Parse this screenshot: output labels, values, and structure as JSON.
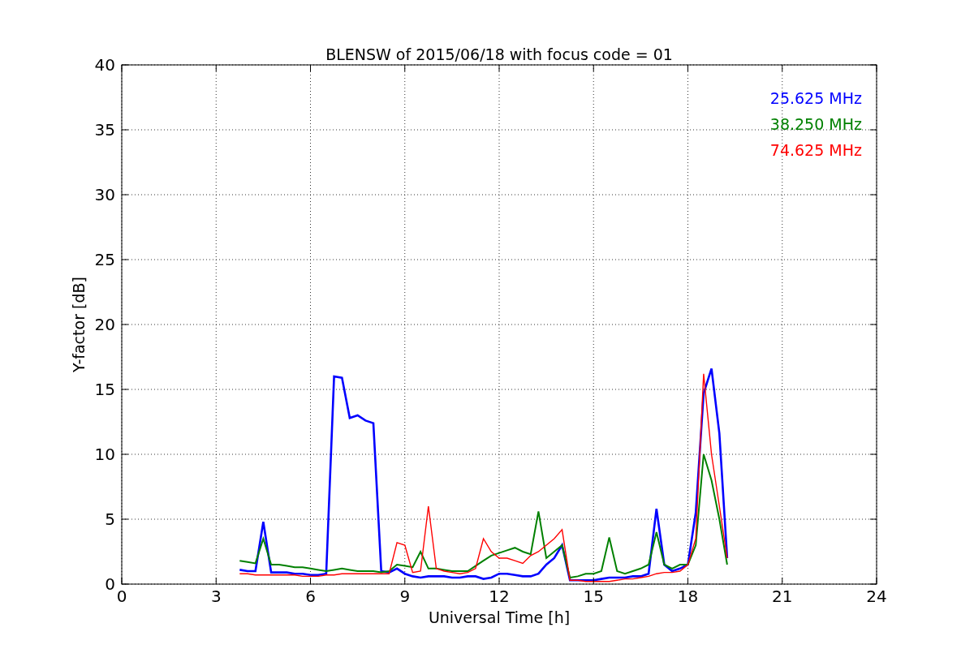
{
  "chart_data": {
    "type": "line",
    "title": "BLENSW of 2015/06/18 with focus code = 01",
    "xlabel": "Universal Time [h]",
    "ylabel": "Y-factor [dB]",
    "x": [
      3.75,
      4,
      4.25,
      4.5,
      4.75,
      5,
      5.25,
      5.5,
      5.75,
      6,
      6.25,
      6.5,
      6.75,
      7,
      7.25,
      7.5,
      7.75,
      8,
      8.25,
      8.5,
      8.75,
      9,
      9.25,
      9.5,
      9.75,
      10,
      10.25,
      10.5,
      10.75,
      11,
      11.25,
      11.5,
      11.75,
      12,
      12.25,
      12.5,
      12.75,
      13,
      13.25,
      13.5,
      13.75,
      14,
      14.25,
      14.5,
      14.75,
      15,
      15.25,
      15.5,
      15.75,
      16,
      16.25,
      16.5,
      16.75,
      17,
      17.25,
      17.5,
      17.75,
      18,
      18.25,
      18.5,
      18.75,
      19,
      19.25
    ],
    "series": [
      {
        "name": "25.625 MHz",
        "color": "#0000ff",
        "values": [
          1.1,
          1.0,
          1.0,
          4.8,
          0.9,
          0.9,
          0.9,
          0.8,
          0.8,
          0.7,
          0.7,
          0.8,
          16.0,
          15.9,
          12.8,
          13.0,
          12.6,
          12.4,
          1.0,
          0.9,
          1.2,
          0.8,
          0.6,
          0.5,
          0.6,
          0.6,
          0.6,
          0.5,
          0.5,
          0.6,
          0.6,
          0.4,
          0.5,
          0.8,
          0.8,
          0.7,
          0.6,
          0.6,
          0.8,
          1.5,
          2.0,
          3.0,
          0.3,
          0.3,
          0.3,
          0.3,
          0.4,
          0.5,
          0.5,
          0.5,
          0.6,
          0.6,
          0.8,
          5.8,
          1.5,
          1.0,
          1.2,
          1.5,
          5.5,
          14.7,
          16.6,
          11.6,
          2.0
        ]
      },
      {
        "name": "38.250 MHz",
        "color": "#008000",
        "values": [
          1.8,
          1.7,
          1.6,
          3.5,
          1.5,
          1.5,
          1.4,
          1.3,
          1.3,
          1.2,
          1.1,
          1.0,
          1.1,
          1.2,
          1.1,
          1.0,
          1.0,
          1.0,
          0.9,
          1.0,
          1.5,
          1.4,
          1.3,
          2.5,
          1.2,
          1.2,
          1.1,
          1.0,
          1.0,
          1.0,
          1.4,
          1.8,
          2.2,
          2.4,
          2.6,
          2.8,
          2.5,
          2.3,
          5.6,
          2.0,
          2.5,
          3.0,
          0.5,
          0.6,
          0.8,
          0.8,
          1.0,
          3.6,
          1.0,
          0.8,
          1.0,
          1.2,
          1.5,
          4.0,
          1.5,
          1.2,
          1.5,
          1.5,
          3.0,
          10.0,
          8.0,
          5.0,
          1.5
        ]
      },
      {
        "name": "74.625 MHz",
        "color": "#ff0000",
        "values": [
          0.8,
          0.8,
          0.7,
          0.7,
          0.7,
          0.7,
          0.7,
          0.7,
          0.6,
          0.6,
          0.6,
          0.7,
          0.7,
          0.8,
          0.8,
          0.8,
          0.8,
          0.8,
          0.8,
          0.8,
          3.2,
          3.0,
          0.9,
          1.0,
          6.0,
          1.2,
          1.0,
          0.9,
          0.8,
          0.9,
          1.2,
          3.5,
          2.5,
          2.0,
          2.0,
          1.8,
          1.6,
          2.2,
          2.5,
          3.0,
          3.5,
          4.2,
          0.3,
          0.3,
          0.2,
          0.2,
          0.2,
          0.2,
          0.3,
          0.4,
          0.4,
          0.5,
          0.6,
          0.8,
          0.9,
          0.9,
          1.0,
          1.5,
          3.5,
          16.2,
          10.0,
          6.0,
          2.0
        ]
      }
    ],
    "xlim": [
      0,
      24
    ],
    "ylim": [
      0,
      40
    ],
    "grid": true,
    "xticks": [
      0,
      3,
      6,
      9,
      12,
      15,
      18,
      21,
      24
    ],
    "yticks": [
      0,
      5,
      10,
      15,
      20,
      25,
      30,
      35,
      40
    ]
  }
}
